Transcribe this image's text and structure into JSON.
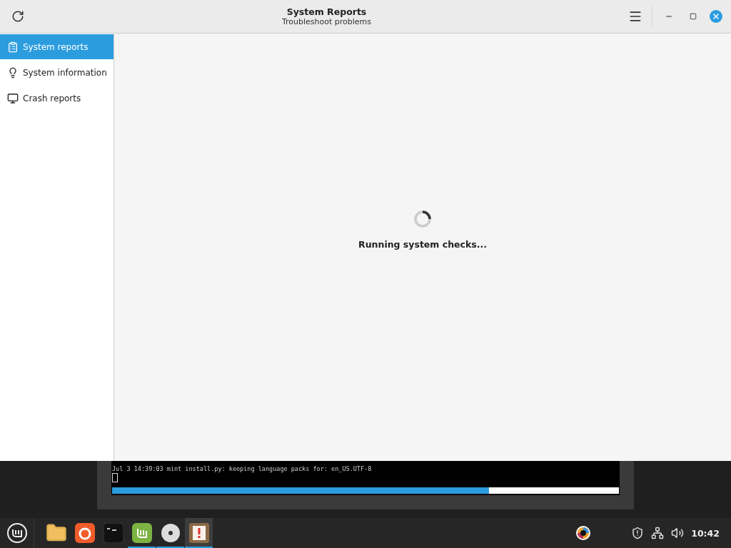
{
  "window": {
    "title": "System Reports",
    "subtitle": "Troubleshoot problems"
  },
  "sidebar": {
    "items": [
      {
        "label": "System reports",
        "kind": "reports",
        "selected": true
      },
      {
        "label": "System information",
        "kind": "info",
        "selected": false
      },
      {
        "label": "Crash reports",
        "kind": "crash",
        "selected": false
      }
    ]
  },
  "content": {
    "status": "Running system checks..."
  },
  "terminal": {
    "lines": [
      "Jul  3 14:39:03 mint install.py: keeping language packs for: en_US.UTF-8"
    ],
    "progress": {
      "level": 0.743
    }
  },
  "taskbar": {
    "apps": [
      {
        "kind": "folder",
        "running": false,
        "selected": false
      },
      {
        "kind": "browser",
        "running": false,
        "selected": false
      },
      {
        "kind": "terminal",
        "running": false,
        "selected": false
      },
      {
        "kind": "store",
        "running": true,
        "selected": false
      },
      {
        "kind": "disc",
        "running": true,
        "selected": false
      },
      {
        "kind": "reports",
        "running": true,
        "selected": true
      }
    ],
    "clock": "10:42"
  }
}
